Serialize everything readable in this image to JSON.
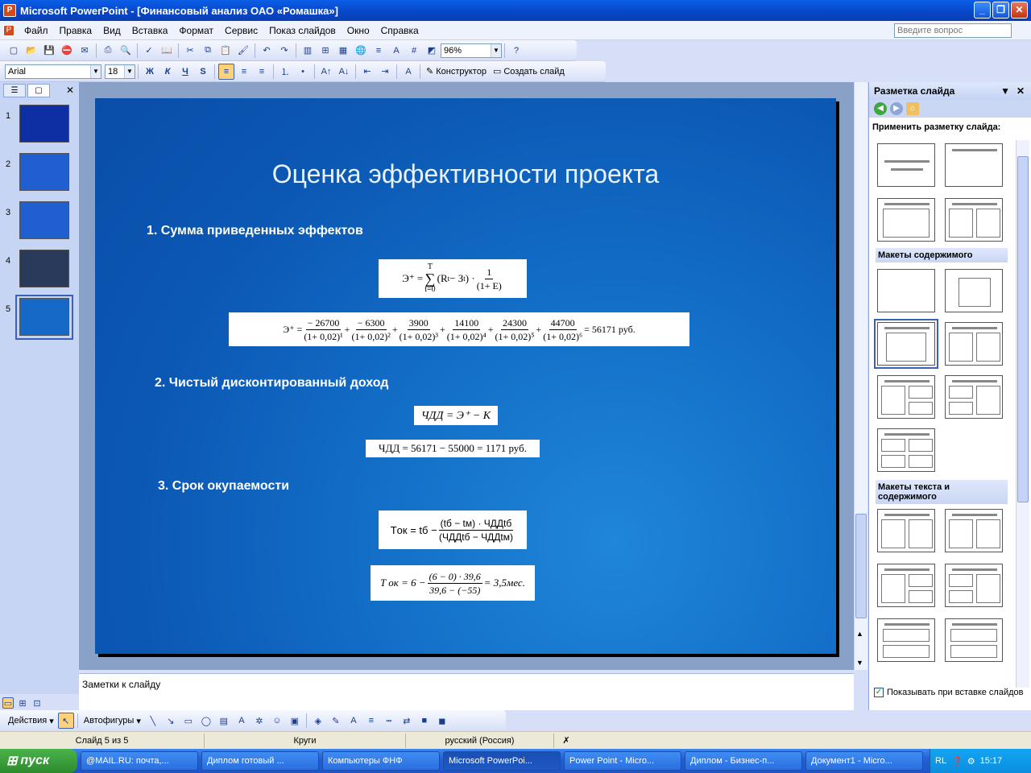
{
  "window": {
    "title": "Microsoft PowerPoint - [Финансовый анализ ОАО «Ромашка»]",
    "controls": [
      "_",
      "❐",
      "✕"
    ],
    "doc_controls": [
      "_",
      "❐",
      "✕"
    ]
  },
  "menu": {
    "items": [
      "Файл",
      "Правка",
      "Вид",
      "Вставка",
      "Формат",
      "Сервис",
      "Показ слайдов",
      "Окно",
      "Справка"
    ],
    "ask_placeholder": "Введите вопрос"
  },
  "toolbar": {
    "zoom": "96%",
    "font": "Arial",
    "size": "18",
    "bold": "Ж",
    "italic": "К",
    "underline": "Ч",
    "shadow": "S",
    "designer": "Конструктор",
    "new_slide": "Создать слайд"
  },
  "thumbs": [
    "1",
    "2",
    "3",
    "4",
    "5"
  ],
  "slide": {
    "title": "Оценка эффективности проекта",
    "h1": "1. Сумма приведенных эффектов",
    "h2": "2. Чистый дисконтированный доход",
    "h3": "3. Срок окупаемости",
    "f1": {
      "lhs": "Э⁺ = ",
      "sum_top": "T",
      "sum_bot": "t=0",
      "body": "(R",
      "body2": " − З",
      "body3": ") · ",
      "frac_n": "1",
      "frac_d": "(1+ E)"
    },
    "f2": {
      "lhs": "Э⁺ = ",
      "terms": [
        [
          "− 26700",
          "(1+ 0,02)¹"
        ],
        [
          "− 6300",
          "(1+ 0,02)²"
        ],
        [
          "3900",
          "(1+ 0,02)³"
        ],
        [
          "14100",
          "(1+ 0,02)⁴"
        ],
        [
          "24300",
          "(1+ 0,02)⁵"
        ],
        [
          "44700",
          "(1+ 0,02)⁶"
        ]
      ],
      "result": "= 56171 руб."
    },
    "f3": "ЧДД = Э⁺ − К",
    "f4": "ЧДД  = 56171 − 55000  = 1171 руб.",
    "f5": {
      "lhs": "Tок = tб − ",
      "n": "(tб − tм) · ЧДДtб",
      "d": "(ЧДДtб − ЧДДtм)"
    },
    "f6": {
      "lhs": "T ок = 6 − ",
      "n": "(6 − 0) · 39,6",
      "d": "39,6 − (−55)",
      "result": " = 3,5мес."
    }
  },
  "notes": {
    "placeholder": "Заметки к слайду"
  },
  "task_pane": {
    "title": "Разметка слайда",
    "apply": "Применить разметку слайда:",
    "section_content": "Макеты содержимого",
    "section_text_content": "Макеты текста и содержимого",
    "show_on_insert": "Показывать при вставке слайдов"
  },
  "drawing": {
    "actions": "Действия",
    "autoshapes": "Автофигуры"
  },
  "status": {
    "slide": "Слайд 5 из 5",
    "design": "Круги",
    "lang": "русский (Россия)"
  },
  "taskbar": {
    "start": "пуск",
    "tasks": [
      "@MAIL.RU: почта,...",
      "Диплом готовый ...",
      "Компьютеры ФНФ",
      "Microsoft PowerPoi...",
      "Power Point - Micro...",
      "Диплом - Бизнес-п...",
      "Документ1 - Micro..."
    ],
    "lang": "RL",
    "time": "15:17"
  }
}
